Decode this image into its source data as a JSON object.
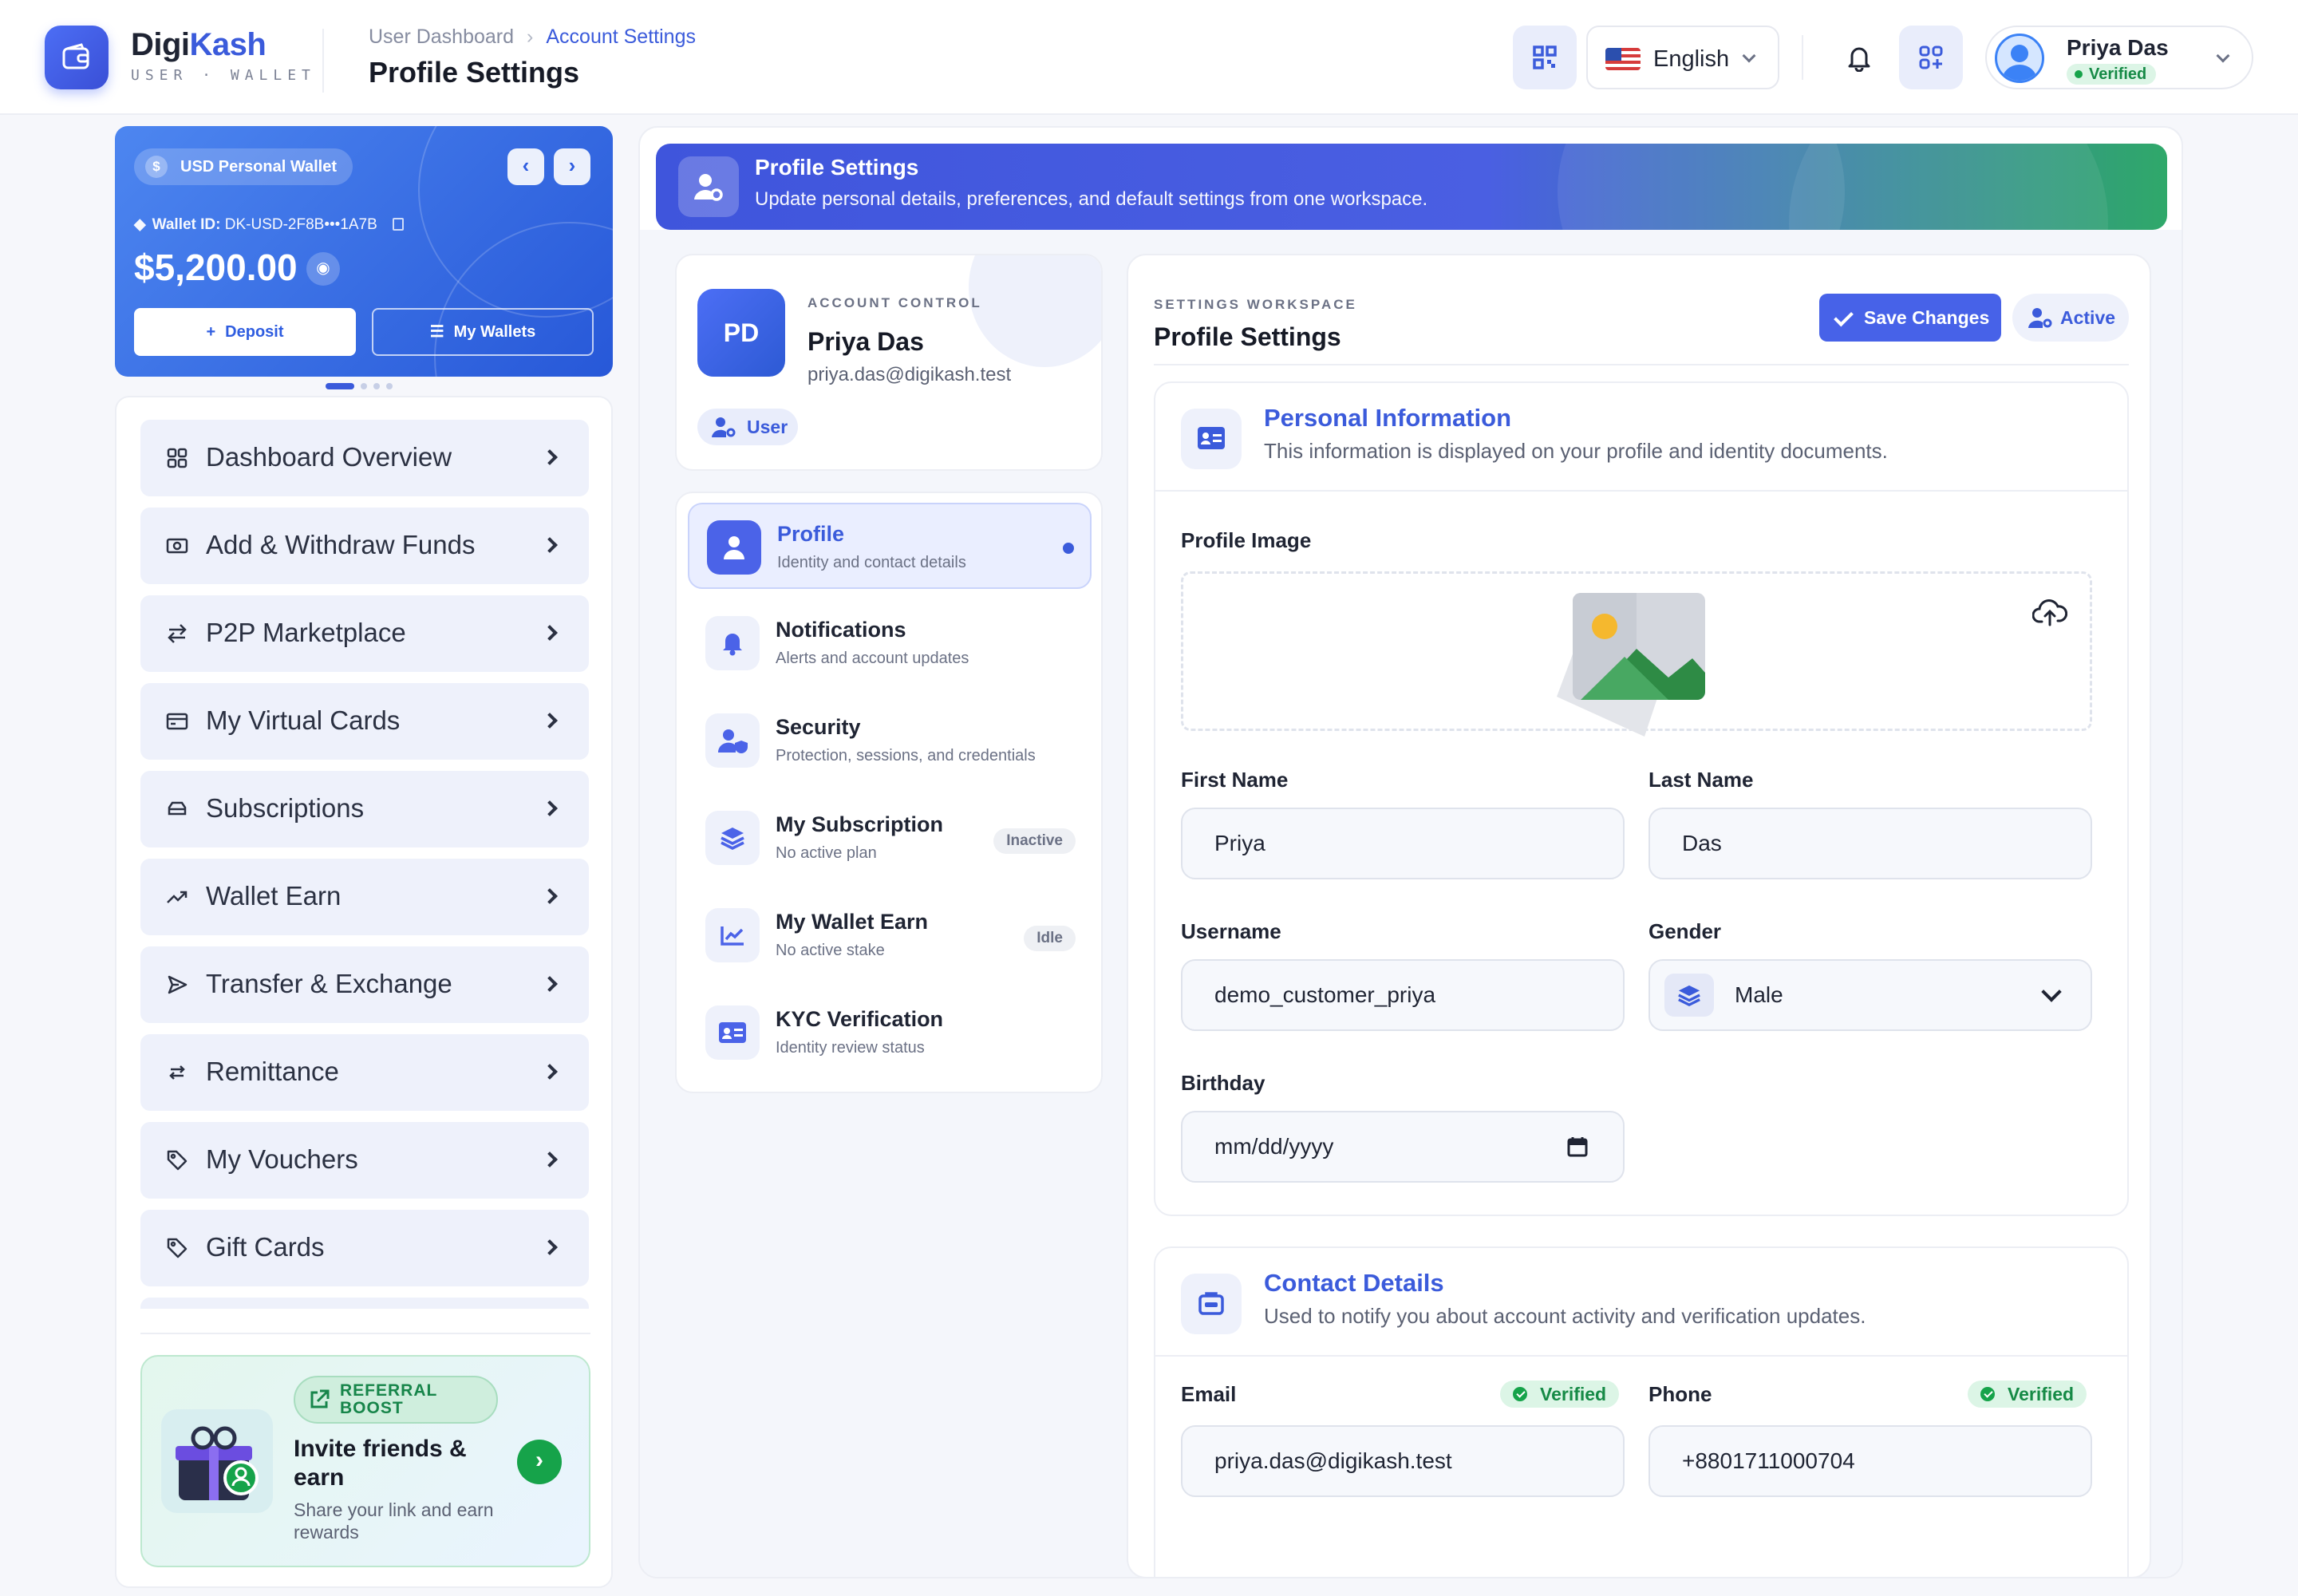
{
  "brand": {
    "name_a": "Digi",
    "name_b": "Kash",
    "sub": "USER · WALLET"
  },
  "header": {
    "breadcrumb": [
      "User Dashboard",
      "Account Settings"
    ],
    "title": "Profile Settings",
    "language": "English",
    "user_name": "Priya Das",
    "user_status": "Verified"
  },
  "wallet": {
    "chip": "USD Personal Wallet",
    "id_label": "Wallet ID:",
    "id": "DK-USD-2F8B•••1A7B",
    "balance": "$5,200.00",
    "deposit": "Deposit",
    "my_wallets": "My Wallets",
    "prev": "‹",
    "next": "›"
  },
  "sidebar": {
    "items": [
      {
        "label": "Dashboard Overview",
        "icon": "grid-icon"
      },
      {
        "label": "Add & Withdraw Funds",
        "icon": "cash-icon"
      },
      {
        "label": "P2P Marketplace",
        "icon": "swap-icon"
      },
      {
        "label": "My Virtual Cards",
        "icon": "card-icon"
      },
      {
        "label": "Subscriptions",
        "icon": "layers-icon"
      },
      {
        "label": "Wallet Earn",
        "icon": "trend-icon"
      },
      {
        "label": "Transfer & Exchange",
        "icon": "send-icon"
      },
      {
        "label": "Remittance",
        "icon": "exchange-icon"
      },
      {
        "label": "My Vouchers",
        "icon": "tag-icon"
      },
      {
        "label": "Gift Cards",
        "icon": "tag-icon"
      }
    ],
    "referral": {
      "tag": "REFERRAL BOOST",
      "title": "Invite friends & earn",
      "sub": "Share your link and earn rewards"
    }
  },
  "banner": {
    "title": "Profile Settings",
    "sub": "Update personal details, preferences, and default settings from one workspace."
  },
  "account": {
    "initials": "PD",
    "label": "ACCOUNT CONTROL",
    "name": "Priya Das",
    "email": "priya.das@digikash.test",
    "role": "User"
  },
  "menu": [
    {
      "title": "Profile",
      "sub": "Identity and contact details",
      "badge": ""
    },
    {
      "title": "Notifications",
      "sub": "Alerts and account updates",
      "badge": ""
    },
    {
      "title": "Security",
      "sub": "Protection, sessions, and credentials",
      "badge": ""
    },
    {
      "title": "My Subscription",
      "sub": "No active plan",
      "badge": "Inactive"
    },
    {
      "title": "My Wallet Earn",
      "sub": "No active stake",
      "badge": "Idle"
    },
    {
      "title": "KYC Verification",
      "sub": "Identity review status",
      "badge": ""
    }
  ],
  "workspace": {
    "label": "SETTINGS WORKSPACE",
    "title": "Profile Settings",
    "save": "Save Changes",
    "status": "Active"
  },
  "personal": {
    "title": "Personal Information",
    "sub": "This information is displayed on your profile and identity documents.",
    "image_label": "Profile Image",
    "first_name_label": "First Name",
    "first_name": "Priya",
    "last_name_label": "Last Name",
    "last_name": "Das",
    "username_label": "Username",
    "username": "demo_customer_priya",
    "gender_label": "Gender",
    "gender": "Male",
    "birthday_label": "Birthday",
    "birthday_placeholder": "mm/dd/yyyy"
  },
  "contact": {
    "title": "Contact Details",
    "sub": "Used to notify you about account activity and verification updates.",
    "email_label": "Email",
    "email": "priya.das@digikash.test",
    "email_status": "Verified",
    "phone_label": "Phone",
    "phone": "+8801711000704",
    "phone_status": "Verified"
  },
  "colors": {
    "accent": "#3b5bdb",
    "success": "#16a34a",
    "wallet": "#2f5de0"
  }
}
